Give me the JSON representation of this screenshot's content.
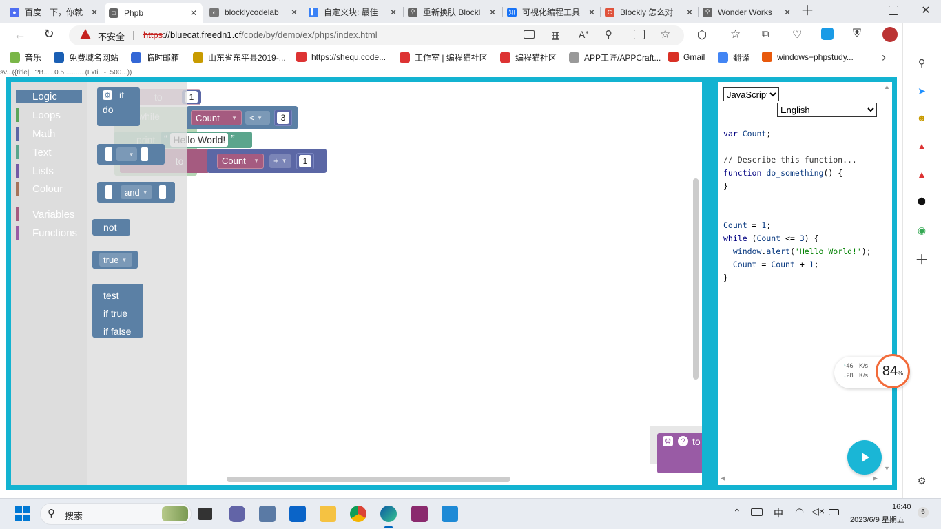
{
  "tabs": [
    {
      "title": "百度一下，你就",
      "color": "#4e6ef2",
      "glyph": "●"
    },
    {
      "title": "Phpb",
      "color": "#666",
      "glyph": "□",
      "active": true
    },
    {
      "title": "blocklycodelab",
      "color": "#777",
      "glyph": "◐"
    },
    {
      "title": "自定义块: 最佳",
      "color": "#3b82f6",
      "glyph": "▍"
    },
    {
      "title": "重新换肤 Blockl",
      "color": "#666",
      "glyph": "⚲"
    },
    {
      "title": "可视化编程工具",
      "color": "#1772f6",
      "glyph": "知"
    },
    {
      "title": "Blockly 怎么对",
      "color": "#e0533c",
      "glyph": "C"
    },
    {
      "title": "Wonder Works",
      "color": "#666",
      "glyph": "⚲"
    }
  ],
  "address": {
    "insecure_label": "不安全",
    "url_scheme": "https",
    "url_host": "://bluecat.freedn1.cf",
    "url_path": "/code/by/demo/ex/phps/index.html"
  },
  "bookmarks": [
    {
      "label": "音乐",
      "icon": "leaf-icon",
      "color": "#7ab648"
    },
    {
      "label": "免费域名网站",
      "icon": "fn-icon",
      "color": "#1a5fb4"
    },
    {
      "label": "临时邮箱",
      "icon": "mail-icon",
      "color": "#3367d6"
    },
    {
      "label": "山东省东平县2019-...",
      "icon": "school-icon",
      "color": "#c89b00"
    },
    {
      "label": "https://shequ.code...",
      "icon": "cat-icon",
      "color": "#d33"
    },
    {
      "label": "工作室 | 编程猫社区",
      "icon": "cat-icon",
      "color": "#d33"
    },
    {
      "label": "编程猫社区",
      "icon": "cat-icon",
      "color": "#d33"
    },
    {
      "label": "APP工匠/APPCraft...",
      "icon": "page-icon",
      "color": "#999"
    },
    {
      "label": "Gmail",
      "icon": "gmail-icon",
      "color": "#d93025"
    },
    {
      "label": "翻译",
      "icon": "translate-icon",
      "color": "#4285f4"
    },
    {
      "label": "windows+phpstudy...",
      "icon": "jian-icon",
      "color": "#e8590c"
    }
  ],
  "page_strip_text": "sv...({title|...?B...l..0.5...........(Lxti...-..500...))",
  "toolbox": {
    "categories": [
      {
        "label": "Logic",
        "color": "#5b80a5"
      },
      {
        "label": "Loops",
        "color": "#5ba55b"
      },
      {
        "label": "Math",
        "color": "#5b67a5"
      },
      {
        "label": "Text",
        "color": "#5ba58c"
      },
      {
        "label": "Lists",
        "color": "#745ba5"
      },
      {
        "label": "Colour",
        "color": "#a5745b"
      },
      {
        "label": "Variables",
        "color": "#a55b80"
      },
      {
        "label": "Functions",
        "color": "#995ba5"
      }
    ]
  },
  "flyout": {
    "if_label": "if",
    "do_label": "do",
    "compare_op": "=",
    "and_op": "and",
    "not_label": "not",
    "true_label": "true",
    "test_label": "test",
    "if_true_label": "if true",
    "if_false_label": "if false"
  },
  "workspace": {
    "set_to": "to",
    "set_value": "1",
    "while_label": "while",
    "count_var": "Count",
    "lte_op": "≤",
    "compare_value": "3",
    "do_label": "do",
    "print_label": "print",
    "text_value": "Hello World!",
    "set_label": "set",
    "to_label": "to",
    "plus_op": "+",
    "add_value": "1",
    "proc_to": "to"
  },
  "code_panel": {
    "language": "JavaScript",
    "locale": "English",
    "code_lines": [
      "var Count;",
      "",
      "// Describe this function...",
      "function do_something() {",
      "}",
      "",
      "",
      "Count = 1;",
      "while (Count <= 3) {",
      "  window.alert('Hello World!');",
      "  Count = Count + 1;",
      "}"
    ]
  },
  "net_widget": {
    "up": "46",
    "down": "28",
    "unit": "K/s",
    "percent": "84",
    "percent_sign": "%"
  },
  "taskbar": {
    "search_label": "搜索",
    "ime": "中",
    "time": "16:40",
    "date": "2023/6/9 星期五",
    "notification_count": "6"
  }
}
